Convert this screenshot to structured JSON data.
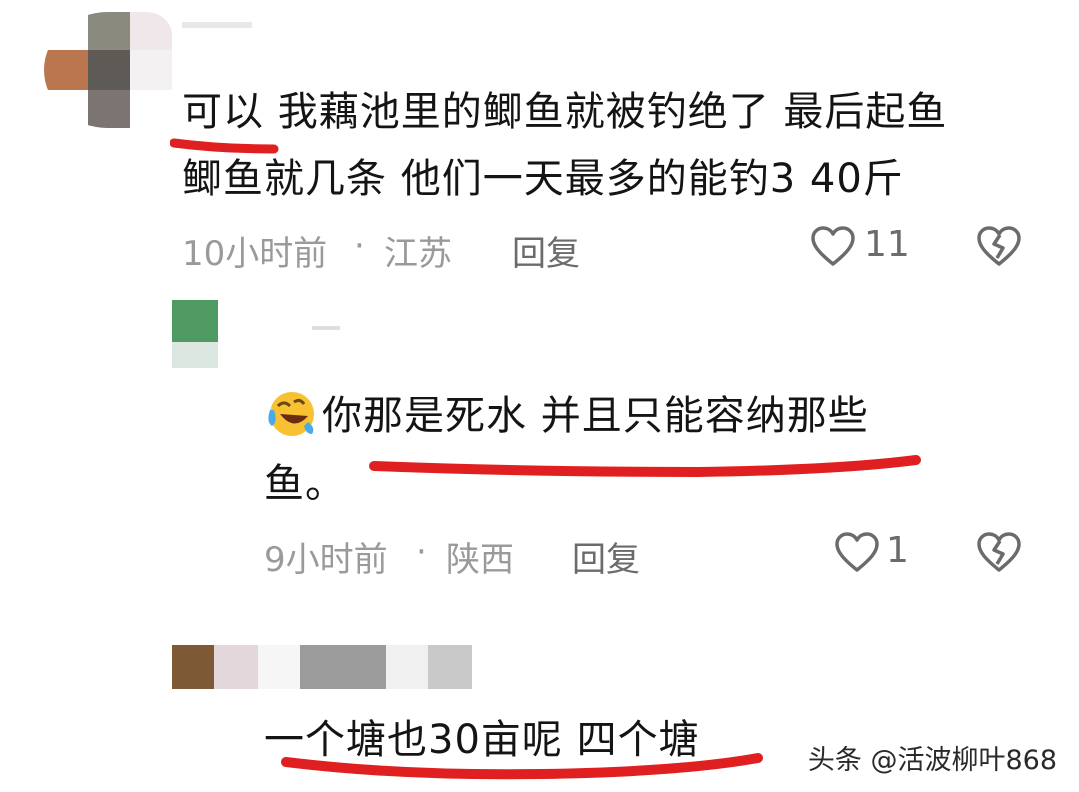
{
  "comments": [
    {
      "lines": [
        "可以 我藕池里的鲫鱼就被钓绝了 最后起鱼",
        "鲫鱼就几条 他们一天最多的能钓3 40斤"
      ],
      "time": "10小时前",
      "location": "江苏",
      "reply_label": "回复",
      "likes": "11"
    },
    {
      "lines": [
        "你那是死水  并且只能容纳那些",
        "鱼。"
      ],
      "time": "9小时前",
      "location": "陕西",
      "reply_label": "回复",
      "likes": "1"
    },
    {
      "lines": [
        "一个塘也30亩呢 四个塘"
      ]
    }
  ],
  "separator": "·",
  "watermark": "头条 @活波柳叶868",
  "colors": {
    "underline": "#e02020",
    "meta": "#9a9a9a"
  }
}
